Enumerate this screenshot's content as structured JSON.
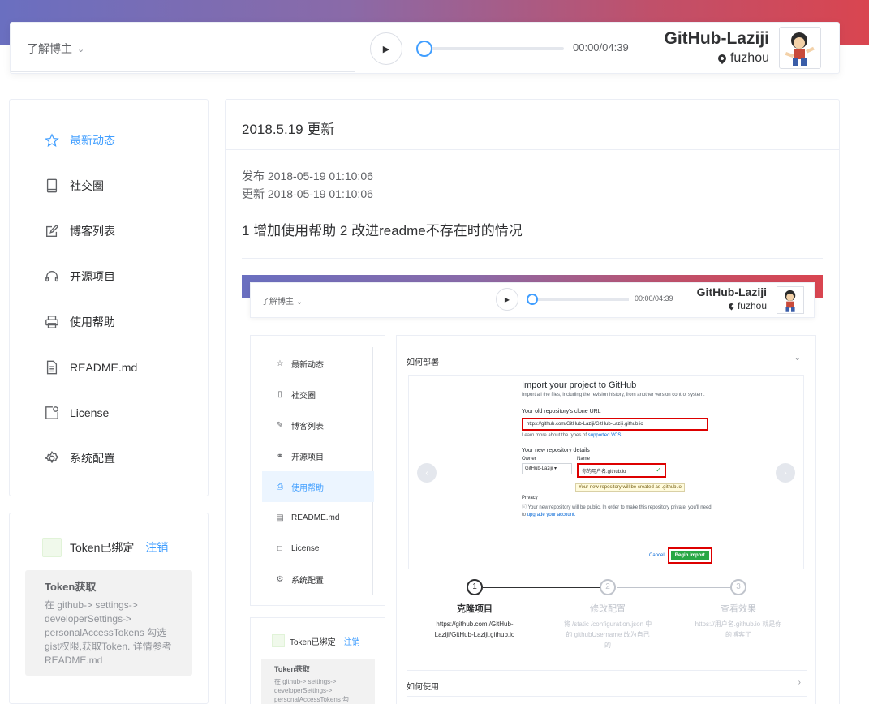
{
  "header": {
    "about_label": "了解博主",
    "time": "00:00/04:39",
    "progress": 0,
    "username": "GitHub-Laziji",
    "location": "fuzhou"
  },
  "sidebar": {
    "items": [
      {
        "label": "最新动态",
        "icon": "star-icon",
        "active": true
      },
      {
        "label": "社交圈",
        "icon": "tablet-icon"
      },
      {
        "label": "博客列表",
        "icon": "edit-icon"
      },
      {
        "label": "开源项目",
        "icon": "headset-icon"
      },
      {
        "label": "使用帮助",
        "icon": "printer-icon"
      },
      {
        "label": "README.md",
        "icon": "document-icon"
      },
      {
        "label": "License",
        "icon": "license-icon"
      },
      {
        "label": "系统配置",
        "icon": "gear-icon"
      }
    ]
  },
  "token": {
    "status": "Token已绑定",
    "logout": "注销",
    "help_title": "Token获取",
    "help_text": "在 github-> settings-> developerSettings-> personalAccessTokens 勾选gist权限,获取Token. 详情参考README.md"
  },
  "content": {
    "title": "2018.5.19 更新",
    "published": "发布 2018-05-19 01:10:06",
    "updated": "更新 2018-05-19 01:10:06",
    "description": "1 增加使用帮助 2 改进readme不存在时的情况"
  },
  "screenshot": {
    "about_label": "了解博主",
    "time": "00:00/04:39",
    "username": "GitHub-Laziji",
    "location": "fuzhou",
    "nav": [
      "最新动态",
      "社交圈",
      "博客列表",
      "开源项目",
      "使用帮助",
      "README.md",
      "License",
      "系统配置"
    ],
    "active_index": 4,
    "token_status": "Token已绑定",
    "token_logout": "注销",
    "token_help_title": "Token获取",
    "token_help_text": "在 github-> settings-> developerSettings-> personalAccessTokens 勾",
    "deploy_title": "如何部署",
    "usage_title": "如何使用",
    "github": {
      "title": "Import your project to GitHub",
      "subtitle": "Import all the files, including the revision history, from another version control system.",
      "old_url_label": "Your old repository's clone URL",
      "old_url": "https://github.com/GitHub-Laziji/GitHub-Laziji.github.io",
      "learn_more": "Learn more about the types of",
      "supported_vcs": "supported VCS.",
      "new_details": "Your new repository details",
      "owner_label": "Owner",
      "owner_value": "GitHub-Laziji ▾",
      "name_label": "Name",
      "name_value": "你的用户名.github.io",
      "name_tip": "Your new repository will be created as .github.io",
      "privacy_label": "Privacy",
      "privacy_text": "Your new repository will be public. In order to make this repository private, you'll need to",
      "upgrade": "upgrade your account.",
      "cancel": "Cancel",
      "begin": "Begin import"
    },
    "steps": [
      {
        "num": "1",
        "title": "克隆项目",
        "desc": "https://github.com /GitHub-Laziji/GitHub-Laziji.github.io",
        "done": true
      },
      {
        "num": "2",
        "title": "修改配置",
        "desc": "将 /static /configuration.json 中的 githubUsername 改为自己的",
        "done": false
      },
      {
        "num": "3",
        "title": "查看效果",
        "desc": "https://用户名.github.io 就是你的博客了",
        "done": false
      }
    ]
  }
}
